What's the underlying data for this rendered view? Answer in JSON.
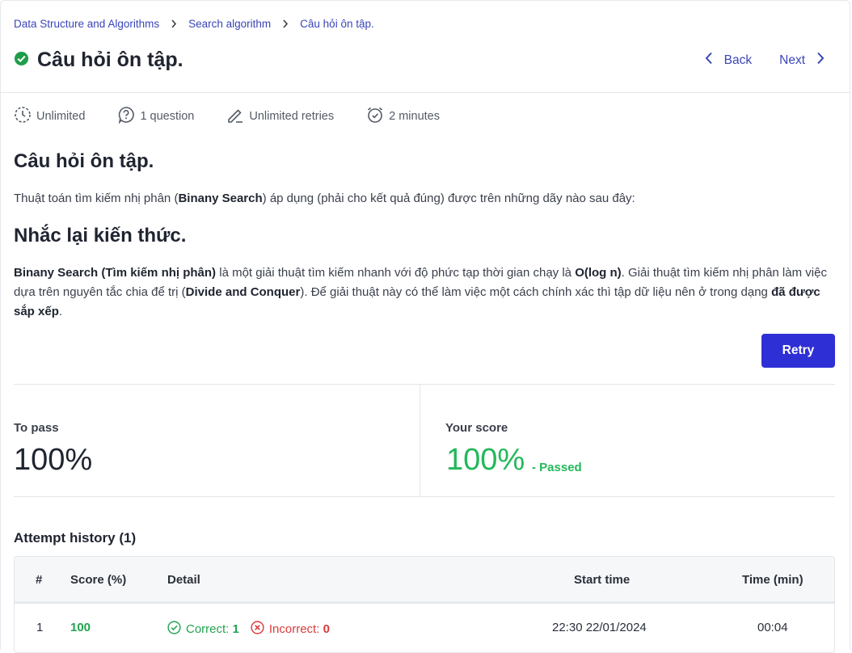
{
  "breadcrumb": [
    "Data Structure and Algorithms",
    "Search algorithm",
    "Câu hỏi ôn tập."
  ],
  "header": {
    "title": "Câu hỏi ôn tập.",
    "back_label": "Back",
    "next_label": "Next"
  },
  "meta": {
    "timing": "Unlimited",
    "questions": "1 question",
    "retries": "Unlimited retries",
    "duration": "2 minutes"
  },
  "content": {
    "heading": "Câu hỏi ôn tập.",
    "question_pre": "Thuật toán tìm kiếm nhị phân (",
    "question_bold": "Binany Search",
    "question_post": ") áp dụng (phải cho kết quả đúng) được trên những dãy nào sau đây:",
    "recap_heading": "Nhắc lại kiến thức.",
    "recap_b1": "Binany Search (Tìm kiếm nhị phân)",
    "recap_t1": " là một giải thuật tìm kiếm nhanh với độ phức tạp thời gian chạy là ",
    "recap_b2": "O(log n)",
    "recap_t2": ". Giải thuật tìm kiếm nhị phân làm việc dựa trên nguyên tắc chia để trị (",
    "recap_b3": "Divide and Conquer",
    "recap_t3": "). Để giải thuật này có thể làm việc một cách chính xác thì tập dữ liệu nên ở trong dạng ",
    "recap_b4": "đã được sắp xếp",
    "recap_t4": "."
  },
  "retry_label": "Retry",
  "score": {
    "to_pass_label": "To pass",
    "to_pass_value": "100%",
    "your_score_label": "Your score",
    "your_score_value": "100%",
    "status": "- Passed"
  },
  "history": {
    "title": "Attempt history (1)",
    "columns": [
      "#",
      "Score (%)",
      "Detail",
      "Start time",
      "Time (min)"
    ],
    "rows": [
      {
        "num": "1",
        "score": "100",
        "correct_label": "Correct:",
        "correct": "1",
        "incorrect_label": "Incorrect:",
        "incorrect": "0",
        "start": "22:30 22/01/2024",
        "time": "00:04"
      }
    ]
  },
  "colors": {
    "accent": "#2f2fd6",
    "link": "#3a45b8",
    "success": "#22b85a",
    "error": "#d93b3b"
  }
}
